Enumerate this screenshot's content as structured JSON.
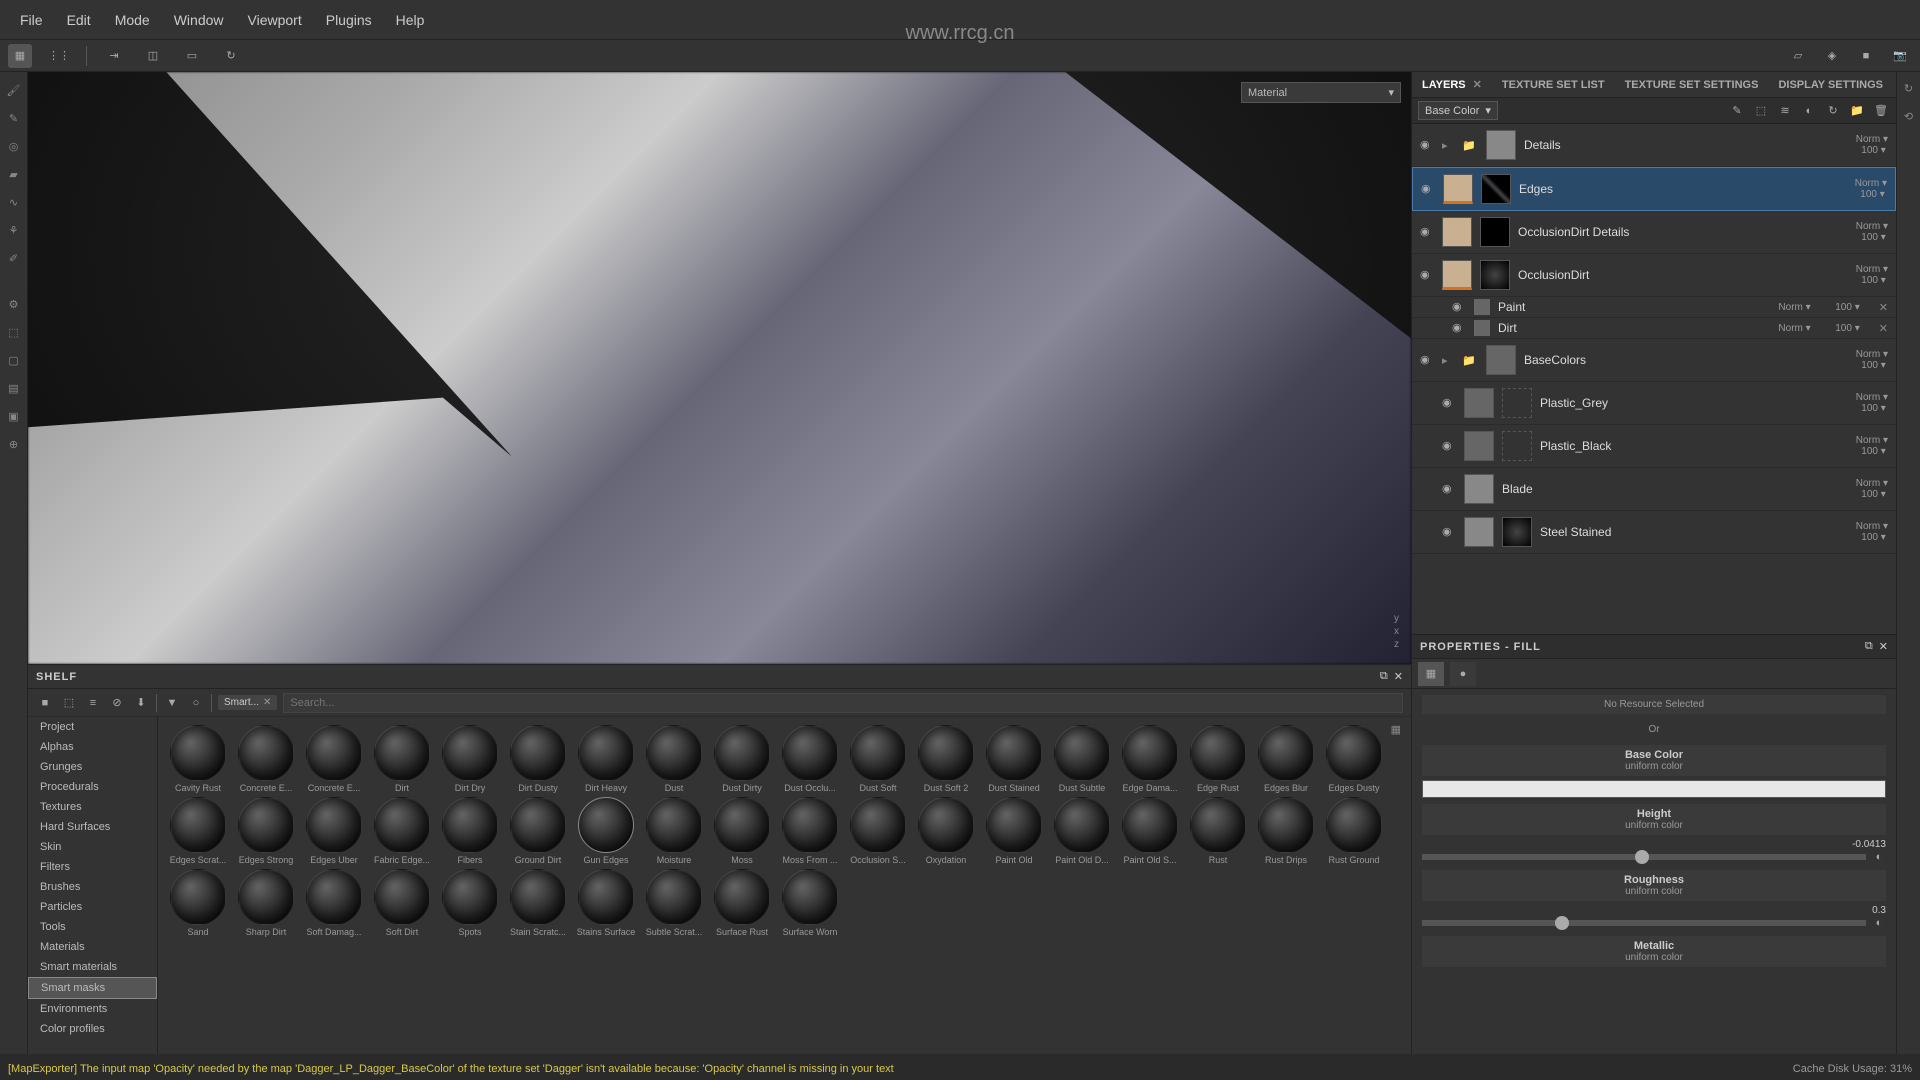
{
  "watermark_url": "www.rrcg.cn",
  "menubar": {
    "items": [
      "File",
      "Edit",
      "Mode",
      "Window",
      "Viewport",
      "Plugins",
      "Help"
    ]
  },
  "panel_tabs": [
    {
      "label": "LAYERS",
      "active": true,
      "closable": true
    },
    {
      "label": "TEXTURE SET LIST",
      "active": false
    },
    {
      "label": "TEXTURE SET SETTINGS",
      "active": false
    },
    {
      "label": "DISPLAY SETTINGS",
      "active": false
    }
  ],
  "viewport": {
    "material_dropdown": "Material",
    "axis": {
      "y": "y",
      "x": "x",
      "z": "z"
    }
  },
  "layers": {
    "channel_dropdown": "Base Color",
    "items": [
      {
        "name": "Details",
        "blend": "Norm",
        "opacity": "100",
        "folder": true,
        "thumb_class": "grid"
      },
      {
        "name": "Edges",
        "blend": "Norm",
        "opacity": "100",
        "selected": true,
        "thumb_class": "tan orange-line",
        "mask_class": "wire"
      },
      {
        "name": "OcclusionDirt Details",
        "blend": "Norm",
        "opacity": "100",
        "thumb_class": "tan",
        "mask_class": "dark"
      },
      {
        "name": "OcclusionDirt",
        "blend": "Norm",
        "opacity": "100",
        "thumb_class": "tan orange-line",
        "mask_class": "noise",
        "sub": [
          {
            "name": "Paint",
            "blend": "Norm",
            "opacity": "100"
          },
          {
            "name": "Dirt",
            "blend": "Norm",
            "opacity": "100"
          }
        ]
      },
      {
        "name": "BaseColors",
        "blend": "Norm",
        "opacity": "100",
        "folder": true,
        "thumb_class": "gray"
      },
      {
        "name": "Plastic_Grey",
        "blend": "Norm",
        "opacity": "100",
        "indent": true,
        "thumb_class": "gray",
        "mask_class": "empty"
      },
      {
        "name": "Plastic_Black",
        "blend": "Norm",
        "opacity": "100",
        "indent": true,
        "thumb_class": "gray",
        "mask_class": "empty"
      },
      {
        "name": "Blade",
        "blend": "Norm",
        "opacity": "100",
        "indent": true,
        "thumb_class": "grid"
      },
      {
        "name": "Steel Stained",
        "blend": "Norm",
        "opacity": "100",
        "indent": true,
        "thumb_class": "grid",
        "mask_class": "noise"
      }
    ]
  },
  "properties": {
    "title": "PROPERTIES - FILL",
    "no_resource": "No Resource Selected",
    "or": "Or",
    "sections": [
      {
        "title": "Base Color",
        "sub": "uniform color",
        "type": "swatch"
      },
      {
        "title": "Height",
        "sub": "uniform color",
        "type": "slider",
        "value": "-0.0413",
        "pos": 48
      },
      {
        "title": "Roughness",
        "sub": "uniform color",
        "type": "slider",
        "value": "0.3",
        "pos": 30
      },
      {
        "title": "Metallic",
        "sub": "uniform color",
        "type": "slider"
      }
    ]
  },
  "shelf": {
    "title": "SHELF",
    "filter_tag": "Smart...",
    "search_placeholder": "Search...",
    "categories": [
      "Project",
      "Alphas",
      "Grunges",
      "Procedurals",
      "Textures",
      "Hard Surfaces",
      "Skin",
      "Filters",
      "Brushes",
      "Particles",
      "Tools",
      "Materials",
      "Smart materials",
      "Smart masks",
      "Environments",
      "Color profiles"
    ],
    "active_category": "Smart masks",
    "items": [
      "Cavity Rust",
      "Concrete E...",
      "Concrete E...",
      "Dirt",
      "Dirt Dry",
      "Dirt Dusty",
      "Dirt Heavy",
      "Dust",
      "Dust Dirty",
      "Dust Occlu...",
      "Dust Soft",
      "Dust Soft 2",
      "Dust Stained",
      "Dust Subtle",
      "Edge Dama...",
      "Edge Rust",
      "Edges Blur",
      "Edges Dusty",
      "Edges Scrat...",
      "Edges Strong",
      "Edges Uber",
      "Fabric Edge...",
      "Fibers",
      "Ground Dirt",
      "Gun Edges",
      "Moisture",
      "Moss",
      "Moss From ...",
      "Occlusion S...",
      "Oxydation",
      "Paint Old",
      "Paint Old D...",
      "Paint Old S...",
      "Rust",
      "Rust Drips",
      "Rust Ground",
      "Sand",
      "Sharp Dirt",
      "Soft Damag...",
      "Soft Dirt",
      "Spots",
      "Stain Scratc...",
      "Stains Surface",
      "Subtle Scrat...",
      "Surface Rust",
      "Surface Worn"
    ],
    "selected_item": "Gun Edges"
  },
  "statusbar": {
    "message": "[MapExporter] The input map 'Opacity' needed by the map 'Dagger_LP_Dagger_BaseColor' of the texture set 'Dagger' isn't available because: 'Opacity' channel is missing in your text",
    "cache": "Cache Disk Usage:   31%"
  }
}
